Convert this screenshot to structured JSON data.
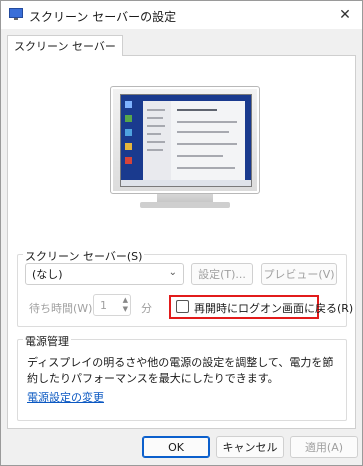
{
  "window": {
    "title": "スクリーン セーバーの設定",
    "close_glyph": "✕"
  },
  "tabs": [
    {
      "label": "スクリーン セーバー"
    }
  ],
  "screensaver": {
    "group_label": "スクリーン セーバー(S)",
    "selected": "(なし)",
    "settings_button": "設定(T)...",
    "preview_button": "プレビュー(V)",
    "wait_label": "待ち時間(W):",
    "wait_value": "1",
    "wait_unit": "分",
    "resume_checkbox_label": "再開時にログオン画面に戻る(R)",
    "resume_checked": false
  },
  "power": {
    "group_label": "電源管理",
    "description": "ディスプレイの明るさや他の電源の設定を調整して、電力を節約したりパフォーマンスを最大にしたりできます。",
    "link": "電源設定の変更"
  },
  "footer": {
    "ok": "OK",
    "cancel": "キャンセル",
    "apply": "適用(A)"
  },
  "colors": {
    "highlight": "#e21b1b",
    "link": "#0b58c2",
    "desktop": "#1a3a8e"
  }
}
